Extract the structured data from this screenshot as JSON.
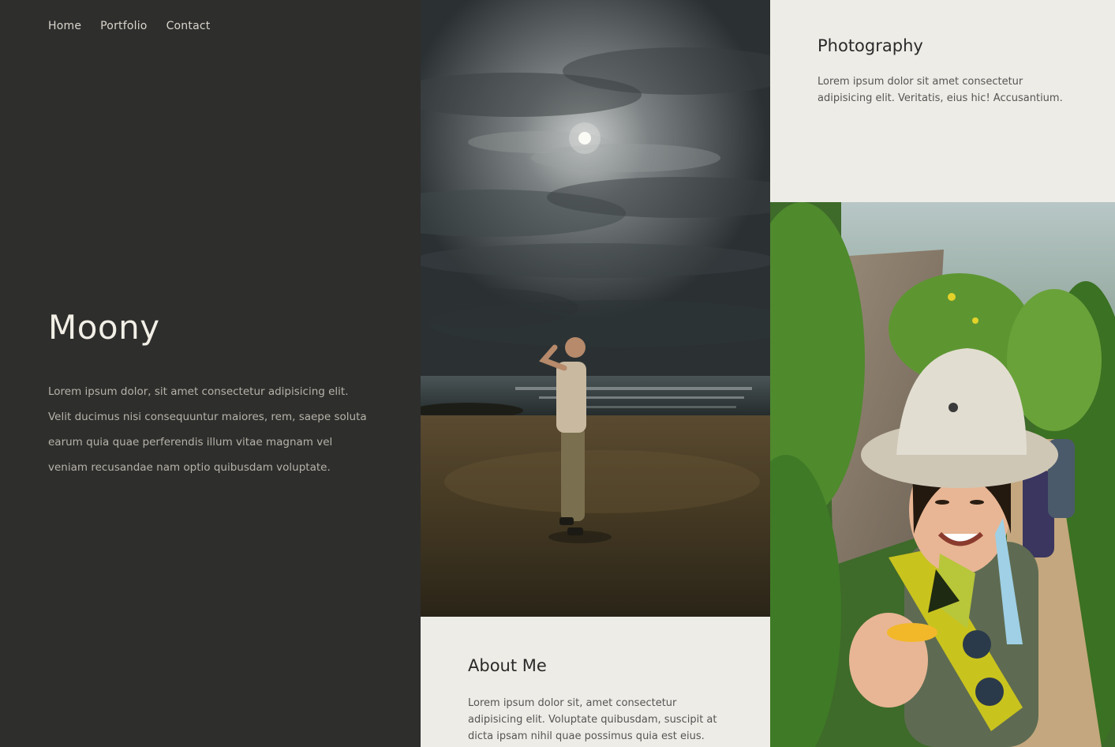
{
  "nav": {
    "items": [
      "Home",
      "Portfolio",
      "Contact"
    ]
  },
  "hero": {
    "title": "Moony",
    "text": "Lorem ipsum dolor, sit amet consectetur adipisicing elit. Velit ducimus nisi consequuntur maiores, rem, saepe soluta earum quia quae perferendis illum vitae magnam vel veniam recusandae nam optio quibusdam voluptate."
  },
  "photography": {
    "title": "Photography",
    "text": "Lorem ipsum dolor sit amet consectetur adipisicing elit. Veritatis, eius hic! Accusantium."
  },
  "about": {
    "title": "About Me",
    "text": "Lorem ipsum dolor sit, amet consectetur adipisicing elit. Voluptate quibusdam, suscipit at dicta ipsam nihil quae possimus quia est eius."
  },
  "colors": {
    "dark_panel": "#2e2e2d",
    "card_bg": "#eeece6",
    "heading_light": "#f2efe6",
    "text_muted": "#b6b3a8"
  }
}
